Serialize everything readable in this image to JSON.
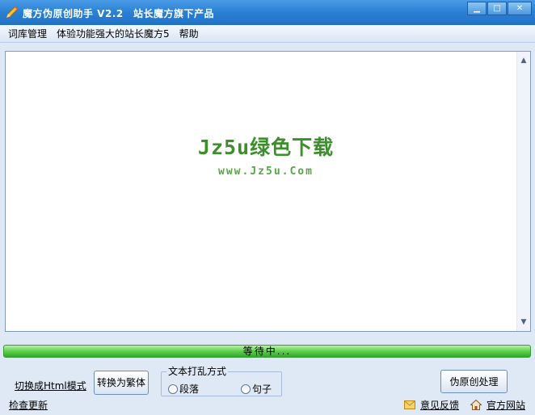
{
  "window": {
    "title": "魔方伪原创助手  V2.2",
    "subtitle": "站长魔方旗下产品",
    "controls": {
      "minimize": "▁",
      "maximize": "□",
      "close": "✕"
    }
  },
  "menu": {
    "items": [
      "词库管理",
      "体验功能强大的站长魔方5",
      "帮助"
    ]
  },
  "editor": {
    "watermark_main": "Jz5u绿色下载",
    "watermark_url": "www.Jz5u.Com",
    "scroll_up": "▲",
    "scroll_down": "▼"
  },
  "status": {
    "progress_text": "等待中..."
  },
  "controls": {
    "html_mode_link": "切换成Html模式",
    "check_update_link": "检查更新",
    "traditional_button": "转换为繁体",
    "shuffle_group_label": "文本打乱方式",
    "radio_paragraph": "段落",
    "radio_sentence": "句子",
    "process_button": "伪原创处理",
    "feedback_link": "意见反馈",
    "website_link": "官方网站"
  },
  "colors": {
    "titlebar": "#2d82d6",
    "progress": "#5ed04b",
    "watermark": "#3c8f2c"
  },
  "icons": {
    "app": "pencil-icon",
    "feedback": "envelope-icon",
    "website": "house-icon"
  }
}
